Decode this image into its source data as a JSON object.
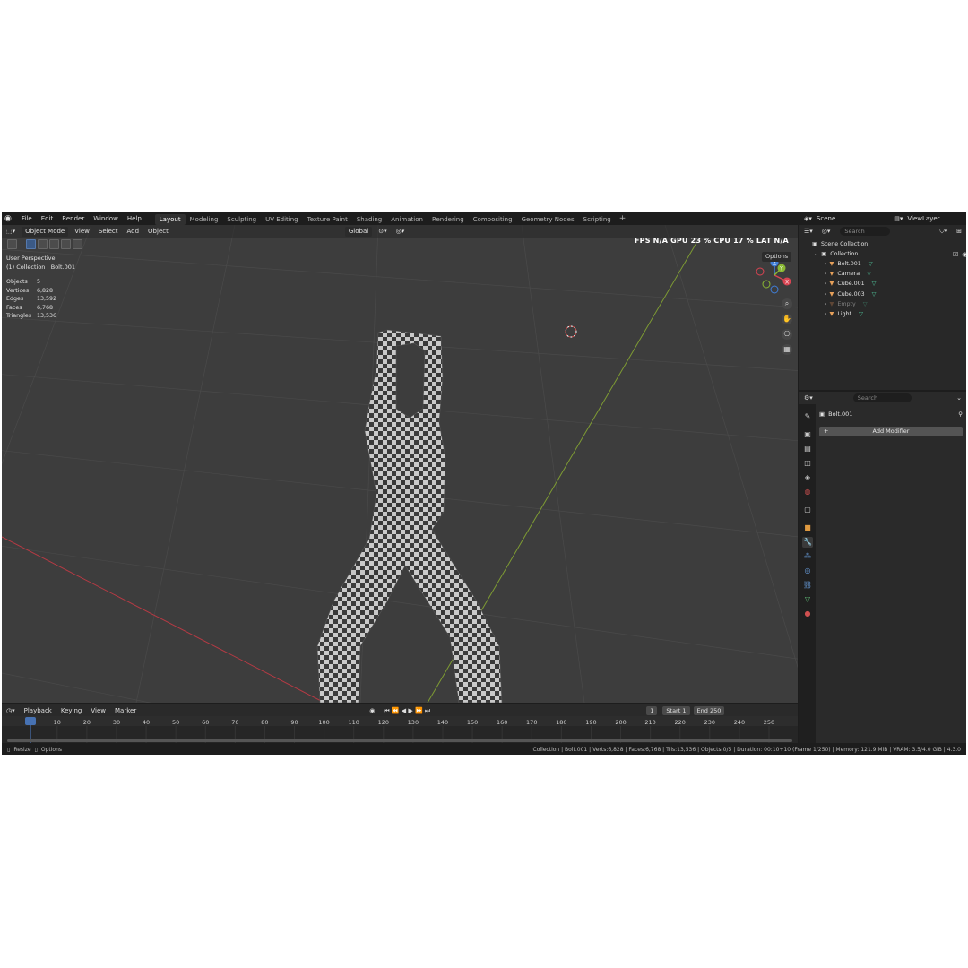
{
  "menu": [
    "File",
    "Edit",
    "Render",
    "Window",
    "Help"
  ],
  "workspaces": [
    "Layout",
    "Modeling",
    "Sculpting",
    "UV Editing",
    "Texture Paint",
    "Shading",
    "Animation",
    "Rendering",
    "Compositing",
    "Geometry Nodes",
    "Scripting"
  ],
  "workspace_add": "+",
  "viewport": {
    "mode": "Object Mode",
    "menus": [
      "View",
      "Select",
      "Add",
      "Object"
    ],
    "transform": "Global",
    "perf_text": "FPS  N/A  GPU  23 %  CPU  17 %  LAT  N/A",
    "options_label": "Options",
    "view_name": "User Perspective",
    "collection_line": "(1) Collection | Bolt.001",
    "stats": [
      {
        "label": "Objects",
        "value": "5"
      },
      {
        "label": "Vertices",
        "value": "6,828"
      },
      {
        "label": "Edges",
        "value": "13,592"
      },
      {
        "label": "Faces",
        "value": "6,768"
      },
      {
        "label": "Triangles",
        "value": "13,536"
      }
    ],
    "gizmo_axes": [
      "Z",
      "Y",
      "X"
    ]
  },
  "timeline": {
    "menus": [
      "Playback",
      "Keying",
      "View",
      "Marker"
    ],
    "current_frame": "1",
    "start_label": "Start",
    "start_value": "1",
    "end_label": "End",
    "end_value": "250",
    "ruler": [
      "1",
      "10",
      "20",
      "30",
      "40",
      "50",
      "60",
      "70",
      "80",
      "90",
      "100",
      "110",
      "120",
      "130",
      "140",
      "150",
      "160",
      "170",
      "180",
      "190",
      "200",
      "210",
      "220",
      "230",
      "240",
      "250"
    ]
  },
  "status": {
    "left_resize": "Resize",
    "left_options": "Options",
    "info": "Collection | Bolt.001 | Verts:6,828 | Faces:6,768 | Tris:13,536 | Objects:0/5 | Duration: 00:10+10 (Frame 1/250) | Memory: 121.9 MiB | VRAM: 3.5/4.0 GiB | 4.3.0"
  },
  "outliner": {
    "scene": "Scene",
    "view_layer": "ViewLayer",
    "search_placeholder": "Search",
    "root": "Scene Collection",
    "collection": "Collection",
    "items": [
      {
        "name": "Bolt.001",
        "icon_color": "#e6a05a",
        "muted": false
      },
      {
        "name": "Camera",
        "icon_color": "#e6a05a",
        "muted": false
      },
      {
        "name": "Cube.001",
        "icon_color": "#e6a05a",
        "muted": false
      },
      {
        "name": "Cube.003",
        "icon_color": "#e6a05a",
        "muted": false
      },
      {
        "name": "Empty",
        "icon_color": "#a36b45",
        "muted": true
      },
      {
        "name": "Light",
        "icon_color": "#e6a05a",
        "muted": false
      }
    ]
  },
  "properties": {
    "search_placeholder": "Search",
    "object_name": "Bolt.001",
    "add_modifier": "Add Modifier"
  },
  "colors": {
    "accent": "#4772b3",
    "x_axis": "#d94452",
    "y_axis": "#8ab833",
    "z_axis": "#3f7fd9"
  }
}
